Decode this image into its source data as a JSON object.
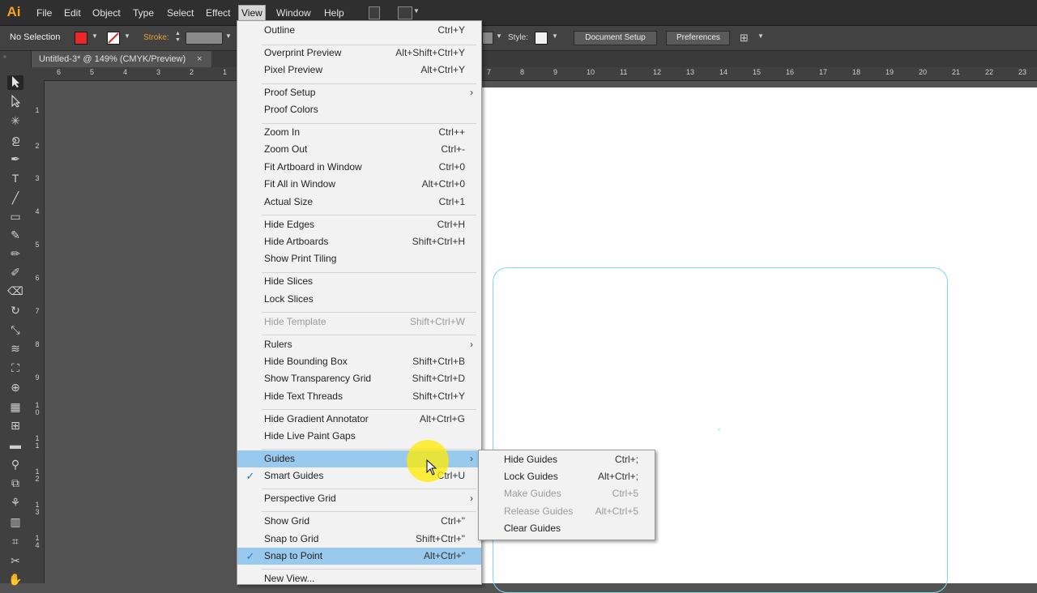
{
  "app": {
    "logo": "Ai"
  },
  "menubar": {
    "items": [
      {
        "label": "File"
      },
      {
        "label": "Edit"
      },
      {
        "label": "Object"
      },
      {
        "label": "Type"
      },
      {
        "label": "Select"
      },
      {
        "label": "Effect"
      },
      {
        "label": "View"
      },
      {
        "label": "Window"
      },
      {
        "label": "Help"
      }
    ],
    "active": "View"
  },
  "controlbar": {
    "selection_label": "No Selection",
    "fill_color": "#e8282b",
    "stroke_label": "Stroke:",
    "style_label": "Style:",
    "document_setup_label": "Document Setup",
    "preferences_label": "Preferences"
  },
  "document_tab": {
    "title": "Untitled-3* @ 149% (CMYK/Preview)",
    "close": "×"
  },
  "rulers": {
    "horizontal": [
      "6",
      "5",
      "4",
      "3",
      "2",
      "1",
      "7",
      "8",
      "9",
      "10",
      "11",
      "12",
      "13",
      "14",
      "15",
      "16",
      "17",
      "18",
      "19",
      "20",
      "21",
      "22",
      "23"
    ],
    "vertical": [
      "1",
      "2",
      "3",
      "4",
      "5",
      "6",
      "7",
      "8",
      "9",
      "10",
      "11",
      "12",
      "13",
      "14"
    ]
  },
  "view_menu": {
    "items": [
      {
        "label": "Outline",
        "shortcut": "Ctrl+Y"
      },
      {
        "label": "Overprint Preview",
        "shortcut": "Alt+Shift+Ctrl+Y"
      },
      {
        "label": "Pixel Preview",
        "shortcut": "Alt+Ctrl+Y"
      },
      {
        "label": "Proof Setup",
        "shortcut": "›"
      },
      {
        "label": "Proof Colors",
        "shortcut": ""
      },
      {
        "label": "Zoom In",
        "shortcut": "Ctrl++"
      },
      {
        "label": "Zoom Out",
        "shortcut": "Ctrl+-"
      },
      {
        "label": "Fit Artboard in Window",
        "shortcut": "Ctrl+0"
      },
      {
        "label": "Fit All in Window",
        "shortcut": "Alt+Ctrl+0"
      },
      {
        "label": "Actual Size",
        "shortcut": "Ctrl+1"
      },
      {
        "label": "Hide Edges",
        "shortcut": "Ctrl+H"
      },
      {
        "label": "Hide Artboards",
        "shortcut": "Shift+Ctrl+H"
      },
      {
        "label": "Show Print Tiling",
        "shortcut": ""
      },
      {
        "label": "Hide Slices",
        "shortcut": ""
      },
      {
        "label": "Lock Slices",
        "shortcut": ""
      },
      {
        "label": "Hide Template",
        "shortcut": "Shift+Ctrl+W"
      },
      {
        "label": "Rulers",
        "shortcut": "›"
      },
      {
        "label": "Hide Bounding Box",
        "shortcut": "Shift+Ctrl+B"
      },
      {
        "label": "Show Transparency Grid",
        "shortcut": "Shift+Ctrl+D"
      },
      {
        "label": "Hide Text Threads",
        "shortcut": "Shift+Ctrl+Y"
      },
      {
        "label": "Hide Gradient Annotator",
        "shortcut": "Alt+Ctrl+G"
      },
      {
        "label": "Hide Live Paint Gaps",
        "shortcut": ""
      },
      {
        "label": "Guides",
        "shortcut": "›"
      },
      {
        "label": "Smart Guides",
        "shortcut": "Ctrl+U",
        "checked": "✓"
      },
      {
        "label": "Perspective Grid",
        "shortcut": "›"
      },
      {
        "label": "Show Grid",
        "shortcut": "Ctrl+\""
      },
      {
        "label": "Snap to Grid",
        "shortcut": "Shift+Ctrl+\""
      },
      {
        "label": "Snap to Point",
        "shortcut": "Alt+Ctrl+\"",
        "checked": "✓"
      },
      {
        "label": "New View...",
        "shortcut": ""
      }
    ]
  },
  "guides_menu": {
    "items": [
      {
        "label": "Hide Guides",
        "shortcut": "Ctrl+;"
      },
      {
        "label": "Lock Guides",
        "shortcut": "Alt+Ctrl+;"
      },
      {
        "label": "Make Guides",
        "shortcut": "Ctrl+5"
      },
      {
        "label": "Release Guides",
        "shortcut": "Alt+Ctrl+5"
      },
      {
        "label": "Clear Guides",
        "shortcut": ""
      }
    ]
  },
  "colors": {
    "highlight": "#9ac9ee",
    "guide": "#7fd7f0",
    "brand": "#f7a21a"
  }
}
